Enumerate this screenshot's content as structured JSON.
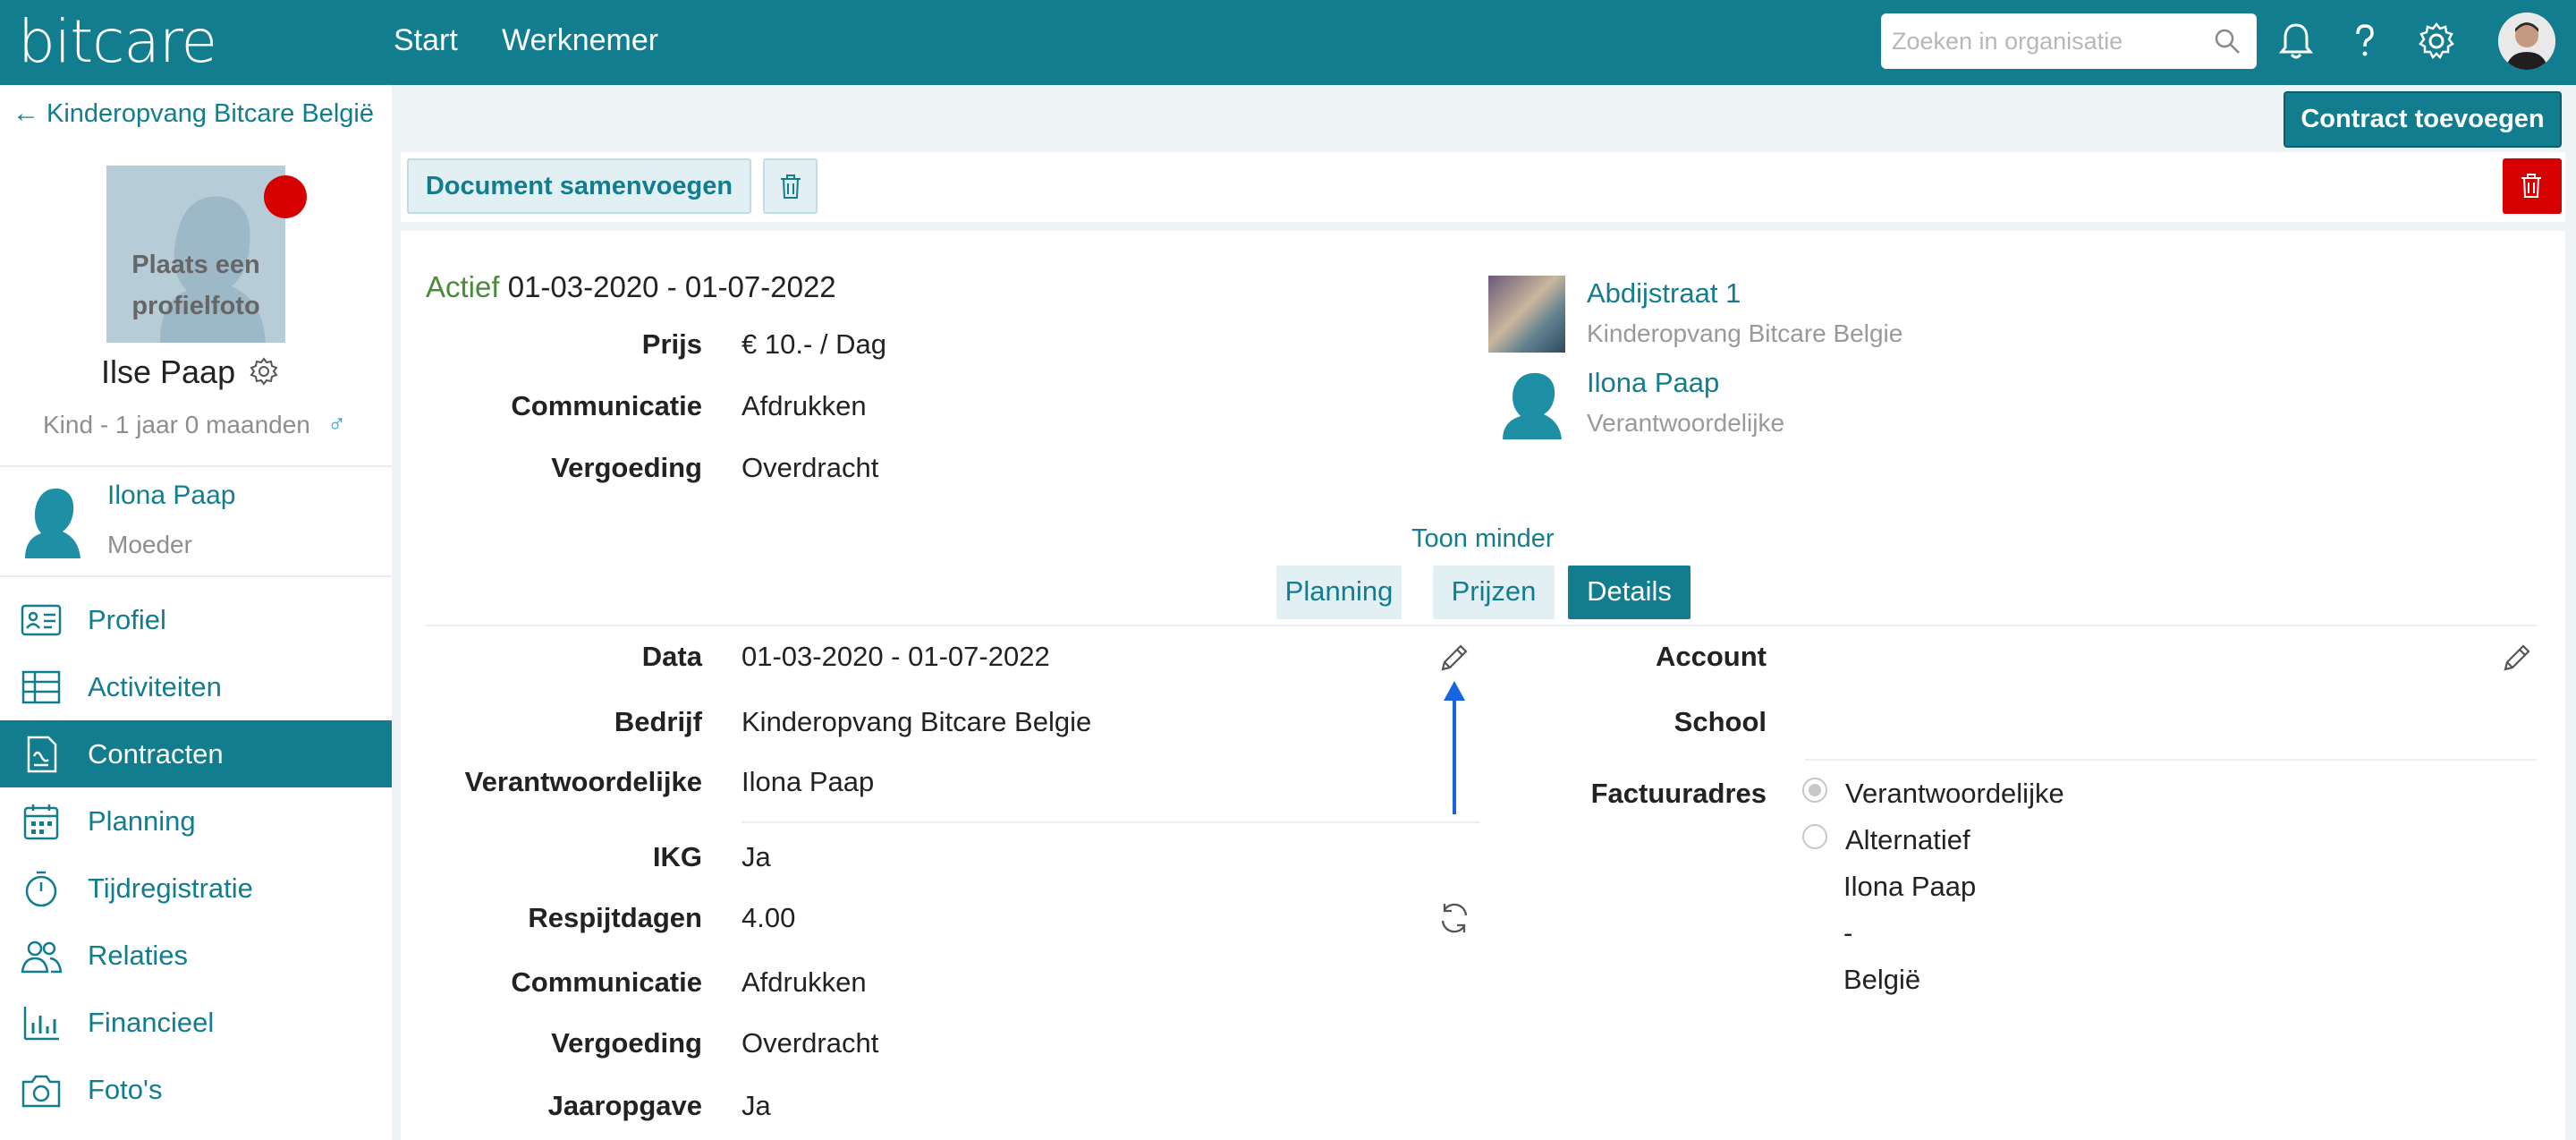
{
  "topbar": {
    "logo": "bitcare",
    "nav_start": "Start",
    "nav_werknemer": "Werknemer",
    "search_placeholder": "Zoeken in organisatie",
    "icons": [
      "bell-icon",
      "help-icon",
      "settings-icon"
    ]
  },
  "sidebar": {
    "back_label": "Kinderopvang Bitcare België",
    "photo_label": "Plaats een profielfoto",
    "child_name": "Ilse Paap",
    "child_info": "Kind - 1 jaar 0 maanden",
    "gender_symbol": "♂",
    "relation": {
      "name": "Ilona Paap",
      "role": "Moeder"
    },
    "menu": [
      {
        "label": "Profiel",
        "icon": "id-card-icon"
      },
      {
        "label": "Activiteiten",
        "icon": "table-icon"
      },
      {
        "label": "Contracten",
        "icon": "contract-icon",
        "active": true
      },
      {
        "label": "Planning",
        "icon": "calendar-icon"
      },
      {
        "label": "Tijdregistratie",
        "icon": "stopwatch-icon"
      },
      {
        "label": "Relaties",
        "icon": "people-icon"
      },
      {
        "label": "Financieel",
        "icon": "bar-chart-icon"
      },
      {
        "label": "Foto's",
        "icon": "camera-icon"
      }
    ]
  },
  "actions": {
    "add_contract": "Contract toevoegen",
    "merge_document": "Document samenvoegen"
  },
  "contract": {
    "status": "Actief",
    "period": "01-03-2020 - 01-07-2022",
    "summary": [
      {
        "label": "Prijs",
        "value": "€ 10.- / Dag"
      },
      {
        "label": "Communicatie",
        "value": "Afdrukken"
      },
      {
        "label": "Vergoeding",
        "value": "Overdracht"
      }
    ],
    "location": {
      "title": "Abdijstraat 1",
      "sub": "Kinderopvang Bitcare Belgie"
    },
    "responsible": {
      "title": "Ilona Paap",
      "sub": "Verantwoordelijke"
    },
    "toggle_label": "Toon minder",
    "tabs": [
      "Planning",
      "Prijzen",
      "Details"
    ],
    "details_left": [
      {
        "label": "Data",
        "value": "01-03-2020 - 01-07-2022"
      },
      {
        "label": "Bedrijf",
        "value": "Kinderopvang Bitcare Belgie"
      },
      {
        "label": "Verantwoordelijke",
        "value": "Ilona Paap"
      },
      {
        "label": "IKG",
        "value": "Ja"
      },
      {
        "label": "Respijtdagen",
        "value": "4.00"
      },
      {
        "label": "Communicatie",
        "value": "Afdrukken"
      },
      {
        "label": "Vergoeding",
        "value": "Overdracht"
      },
      {
        "label": "Jaaropgave",
        "value": "Ja"
      }
    ],
    "details_right": {
      "account_label": "Account",
      "school_label": "School",
      "billing_label": "Factuuradres",
      "billing_options": [
        "Verantwoordelijke",
        "Alternatief"
      ],
      "address_lines": [
        "Ilona Paap",
        "-",
        "België"
      ]
    }
  },
  "colors": {
    "primary": "#127d8e",
    "danger": "#d70000",
    "status_green": "#4b8a3a",
    "arrow": "#1565e0"
  }
}
